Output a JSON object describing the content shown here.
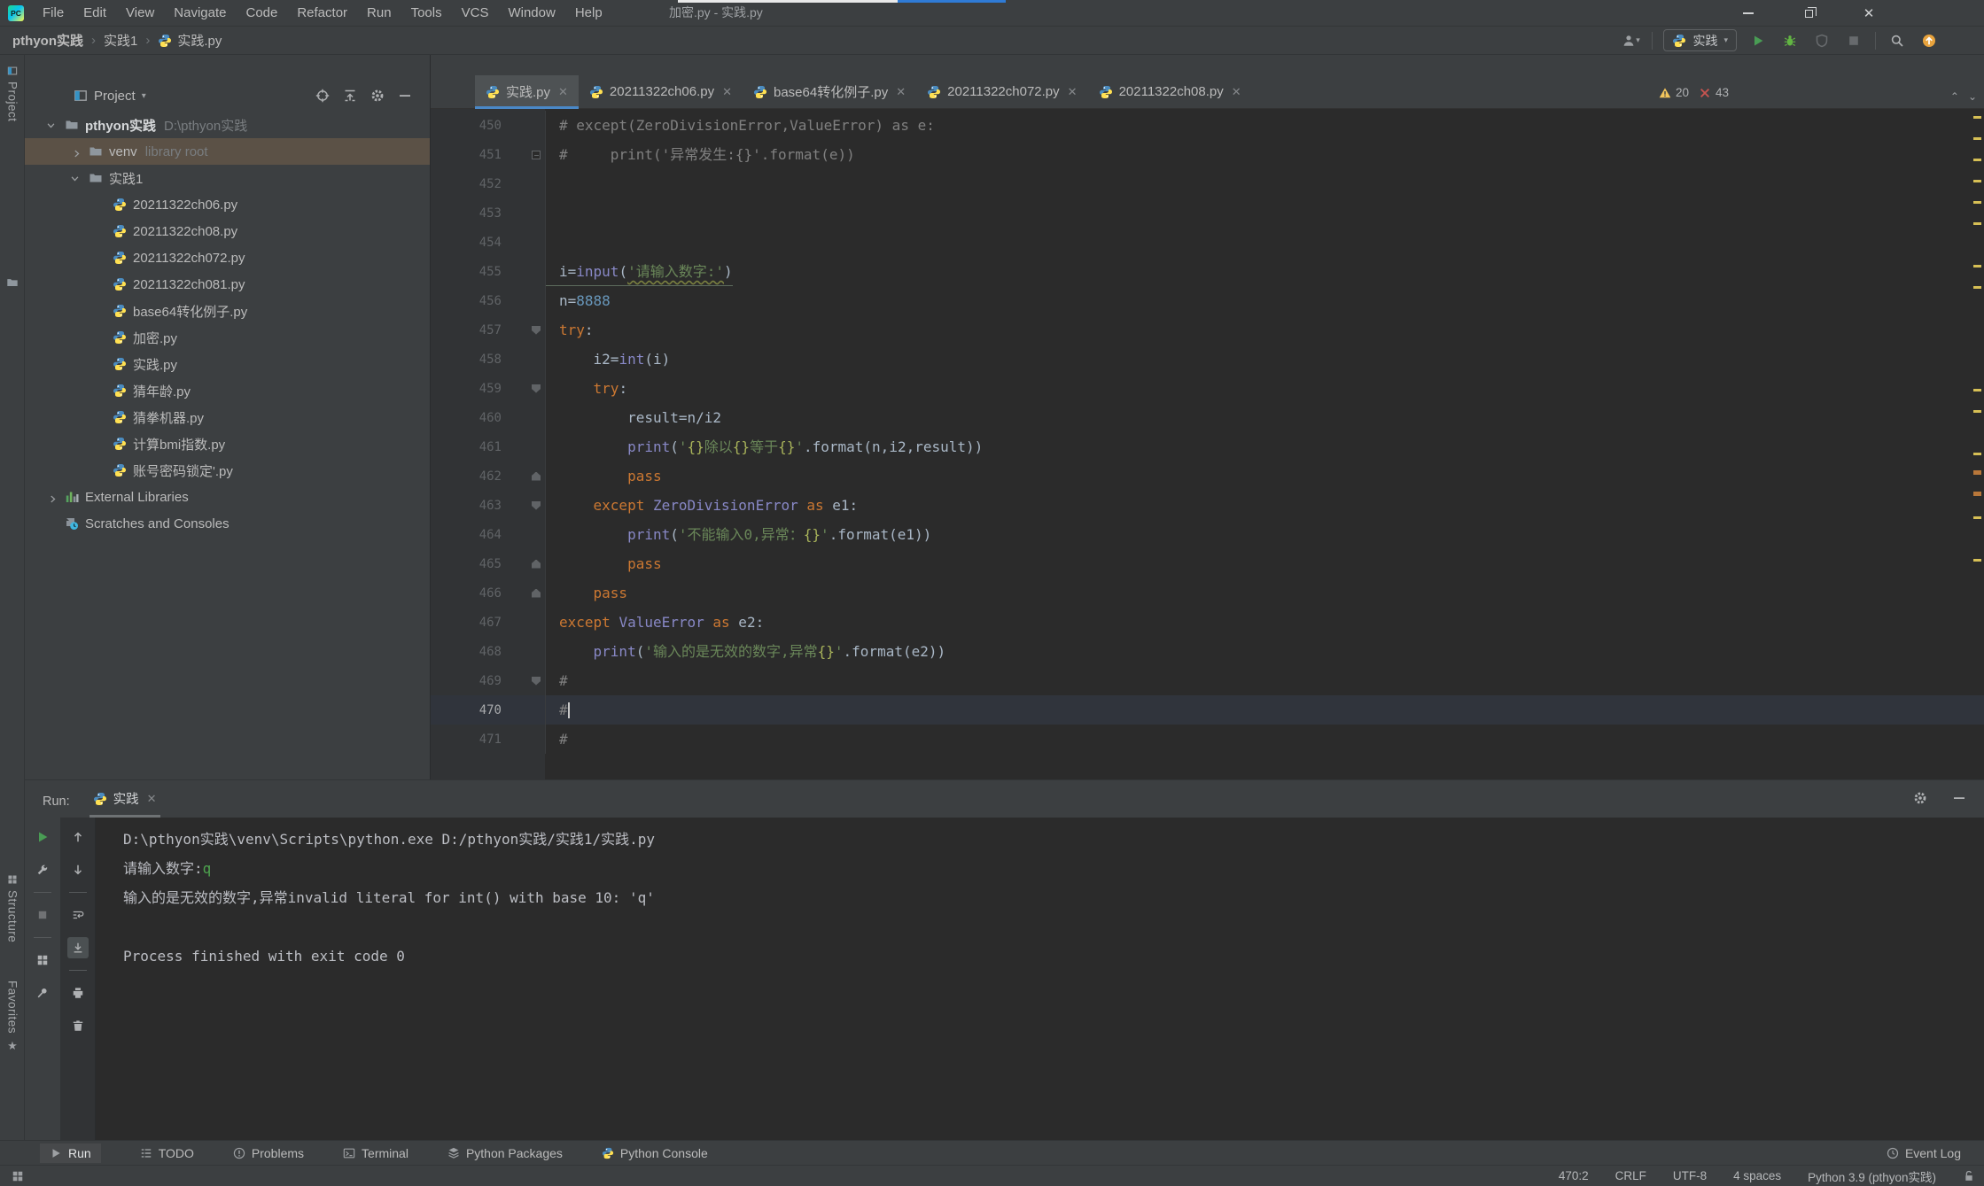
{
  "titlebar": {
    "logo": "PC",
    "menus": [
      "File",
      "Edit",
      "View",
      "Navigate",
      "Code",
      "Refactor",
      "Run",
      "Tools",
      "VCS",
      "Window",
      "Help"
    ],
    "title": "加密.py - 实践.py"
  },
  "breadcrumb": {
    "items": [
      "pthyon实践",
      "实践1",
      "实践.py"
    ]
  },
  "toolbar": {
    "run_config": "实践"
  },
  "left_stripe": {
    "project": "Project",
    "structure": "Structure",
    "favorites": "Favorites",
    "star": "★"
  },
  "project_panel": {
    "header": "Project",
    "tree": [
      {
        "label": "pthyon实践",
        "suffix": "D:\\pthyon实践",
        "type": "folder",
        "indent": 0,
        "chevron": "open",
        "bold": true
      },
      {
        "label": "venv",
        "suffix": "library root",
        "type": "folder",
        "indent": 1,
        "chevron": "closed",
        "selected": true
      },
      {
        "label": "实践1",
        "type": "folder",
        "indent": 1,
        "chevron": "open"
      },
      {
        "label": "20211322ch06.py",
        "type": "py",
        "indent": 2
      },
      {
        "label": "20211322ch08.py",
        "type": "py",
        "indent": 2
      },
      {
        "label": "20211322ch072.py",
        "type": "py",
        "indent": 2
      },
      {
        "label": "20211322ch081.py",
        "type": "py",
        "indent": 2
      },
      {
        "label": "base64转化例子.py",
        "type": "py",
        "indent": 2
      },
      {
        "label": "加密.py",
        "type": "py",
        "indent": 2
      },
      {
        "label": "实践.py",
        "type": "py",
        "indent": 2
      },
      {
        "label": "猜年龄.py",
        "type": "py",
        "indent": 2
      },
      {
        "label": "猜拳机器.py",
        "type": "py",
        "indent": 2
      },
      {
        "label": "计算bmi指数.py",
        "type": "py",
        "indent": 2
      },
      {
        "label": "账号密码锁定'.py",
        "type": "py",
        "indent": 2
      },
      {
        "label": "External Libraries",
        "type": "lib",
        "indent": 0,
        "chevron": "closed"
      },
      {
        "label": "Scratches and Consoles",
        "type": "scratch",
        "indent": 0
      }
    ]
  },
  "tabs": [
    {
      "label": "实践.py",
      "active": true
    },
    {
      "label": "20211322ch06.py",
      "active": false
    },
    {
      "label": "base64转化例子.py",
      "active": false
    },
    {
      "label": "20211322ch072.py",
      "active": false
    },
    {
      "label": "20211322ch08.py",
      "active": false
    }
  ],
  "inspections": {
    "warnings": "20",
    "errors": "43"
  },
  "editor": {
    "current_line": 470,
    "lines": [
      {
        "no": 450,
        "fold": "",
        "segs": [
          [
            "# except(ZeroDivisionError,ValueError) as e:",
            "c"
          ]
        ]
      },
      {
        "no": 451,
        "fold": "box",
        "segs": [
          [
            "#     print('异常发生:{}'.format(e))",
            "c"
          ]
        ]
      },
      {
        "no": 452,
        "fold": "",
        "segs": []
      },
      {
        "no": 453,
        "fold": "",
        "segs": []
      },
      {
        "no": 454,
        "fold": "",
        "segs": []
      },
      {
        "no": 455,
        "fold": "",
        "u": true,
        "segs": [
          [
            "i=",
            "d"
          ],
          [
            "input",
            "b"
          ],
          [
            "(",
            "d"
          ],
          [
            "'请输入数字:'",
            "sw"
          ],
          [
            ")",
            "d"
          ]
        ]
      },
      {
        "no": 456,
        "fold": "",
        "segs": [
          [
            "n=",
            "d"
          ],
          [
            "8888",
            "n"
          ]
        ]
      },
      {
        "no": 457,
        "fold": "down",
        "segs": [
          [
            "try",
            "k"
          ],
          [
            ":",
            "d"
          ]
        ]
      },
      {
        "no": 458,
        "fold": "",
        "segs": [
          [
            "    i2=",
            "d"
          ],
          [
            "int",
            "b"
          ],
          [
            "(i)",
            "d"
          ]
        ]
      },
      {
        "no": 459,
        "fold": "down",
        "segs": [
          [
            "    ",
            "d"
          ],
          [
            "try",
            "k"
          ],
          [
            ":",
            "d"
          ]
        ]
      },
      {
        "no": 460,
        "fold": "",
        "segs": [
          [
            "        result=n/i2",
            "d"
          ]
        ]
      },
      {
        "no": 461,
        "fold": "",
        "segs": [
          [
            "        ",
            "d"
          ],
          [
            "print",
            "b"
          ],
          [
            "(",
            "d"
          ],
          [
            "'",
            "s"
          ],
          [
            "{}",
            "br"
          ],
          [
            "除以",
            "s"
          ],
          [
            "{}",
            "br"
          ],
          [
            "等于",
            "s"
          ],
          [
            "{}",
            "br"
          ],
          [
            "'",
            "s"
          ],
          [
            ".format(n,i2,result))",
            "d"
          ]
        ]
      },
      {
        "no": 462,
        "fold": "up",
        "segs": [
          [
            "        ",
            "d"
          ],
          [
            "pass",
            "k"
          ]
        ]
      },
      {
        "no": 463,
        "fold": "down",
        "segs": [
          [
            "    ",
            "d"
          ],
          [
            "except",
            "k"
          ],
          [
            " ",
            "d"
          ],
          [
            "ZeroDivisionError",
            "b"
          ],
          [
            " ",
            "d"
          ],
          [
            "as",
            "k"
          ],
          [
            " e1:",
            "d"
          ]
        ]
      },
      {
        "no": 464,
        "fold": "",
        "segs": [
          [
            "        ",
            "d"
          ],
          [
            "print",
            "b"
          ],
          [
            "(",
            "d"
          ],
          [
            "'不能输入0,异常：",
            "s"
          ],
          [
            "{}",
            "br"
          ],
          [
            "'",
            "s"
          ],
          [
            ".format(e1))",
            "d"
          ]
        ]
      },
      {
        "no": 465,
        "fold": "up",
        "segs": [
          [
            "        ",
            "d"
          ],
          [
            "pass",
            "k"
          ]
        ]
      },
      {
        "no": 466,
        "fold": "up",
        "segs": [
          [
            "    ",
            "d"
          ],
          [
            "pass",
            "k"
          ]
        ]
      },
      {
        "no": 467,
        "fold": "",
        "segs": [
          [
            "except",
            "k"
          ],
          [
            " ",
            "d"
          ],
          [
            "ValueError",
            "b"
          ],
          [
            " ",
            "d"
          ],
          [
            "as",
            "k"
          ],
          [
            " e2:",
            "d"
          ]
        ]
      },
      {
        "no": 468,
        "fold": "",
        "segs": [
          [
            "    ",
            "d"
          ],
          [
            "print",
            "b"
          ],
          [
            "(",
            "d"
          ],
          [
            "'输入的是无效的数字,异常",
            "s"
          ],
          [
            "{}",
            "br"
          ],
          [
            "'",
            "s"
          ],
          [
            ".format(e2))",
            "d"
          ]
        ]
      },
      {
        "no": 469,
        "fold": "down",
        "segs": [
          [
            "#",
            "c"
          ]
        ]
      },
      {
        "no": 470,
        "fold": "",
        "segs": [
          [
            "#",
            "c"
          ]
        ]
      },
      {
        "no": 471,
        "fold": "",
        "segs": [
          [
            "#",
            "c"
          ]
        ]
      }
    ],
    "stripe_warn_y": [
      8,
      32,
      56,
      80,
      104,
      128,
      176,
      200,
      316,
      340,
      388,
      460,
      508
    ],
    "stripe_err_y": [
      408,
      432
    ]
  },
  "run": {
    "label": "Run:",
    "tab": "实践",
    "console": [
      {
        "segs": [
          [
            "D:\\pthyon实践\\venv\\Scripts\\python.exe D:/pthyon实践/实践1/实践.py",
            "out"
          ]
        ]
      },
      {
        "segs": [
          [
            "请输入数字:",
            "out"
          ],
          [
            "q",
            "in"
          ]
        ]
      },
      {
        "segs": [
          [
            "输入的是无效的数字,异常invalid literal for int() with base 10: 'q'",
            "out"
          ]
        ]
      },
      {
        "segs": []
      },
      {
        "segs": [
          [
            "Process finished with exit code 0",
            "out"
          ]
        ]
      }
    ]
  },
  "bottom_bar": {
    "items": [
      "Run",
      "TODO",
      "Problems",
      "Terminal",
      "Python Packages",
      "Python Console"
    ],
    "event_log": "Event Log"
  },
  "status_bar": {
    "caret": "470:2",
    "line_ending": "CRLF",
    "encoding": "UTF-8",
    "indent": "4 spaces",
    "interpreter": "Python 3.9 (pthyon实践)"
  }
}
